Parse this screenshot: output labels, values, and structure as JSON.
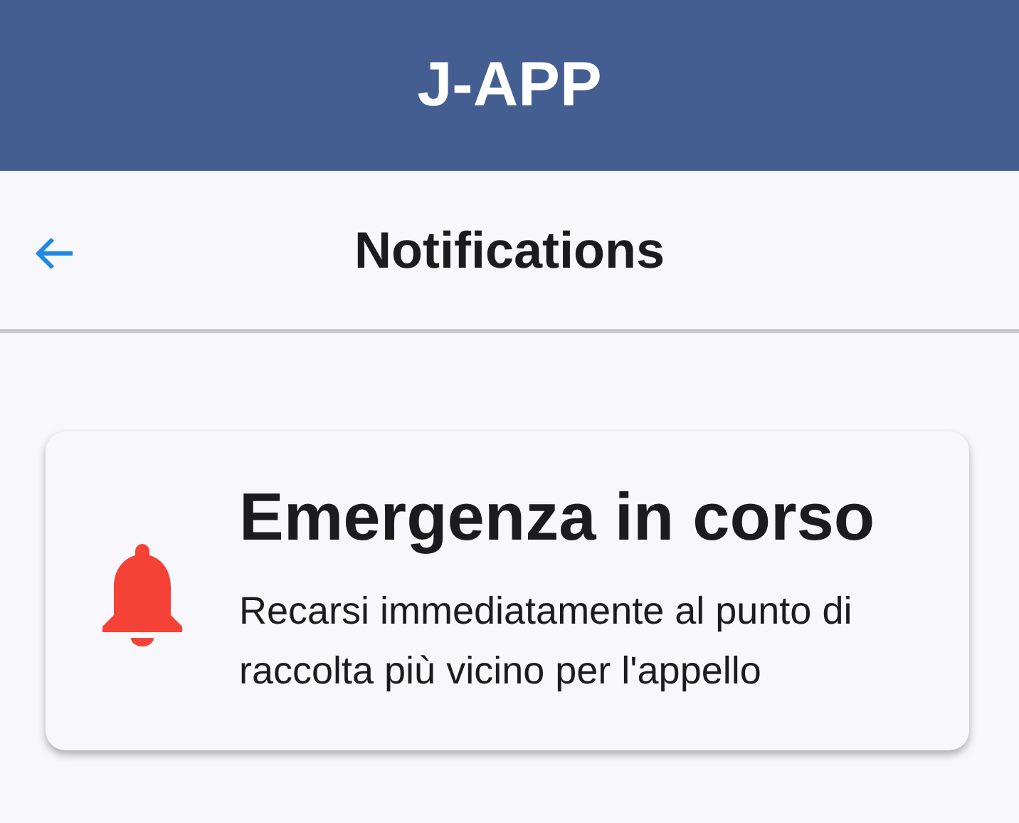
{
  "app_bar": {
    "title": "J-APP"
  },
  "nav_bar": {
    "title": "Notifications"
  },
  "notifications": [
    {
      "kind": "alert",
      "title": "Emergenza in corso",
      "message": "Recarsi immediatamente al punto di raccolta più vicino per l'appello"
    }
  ]
}
